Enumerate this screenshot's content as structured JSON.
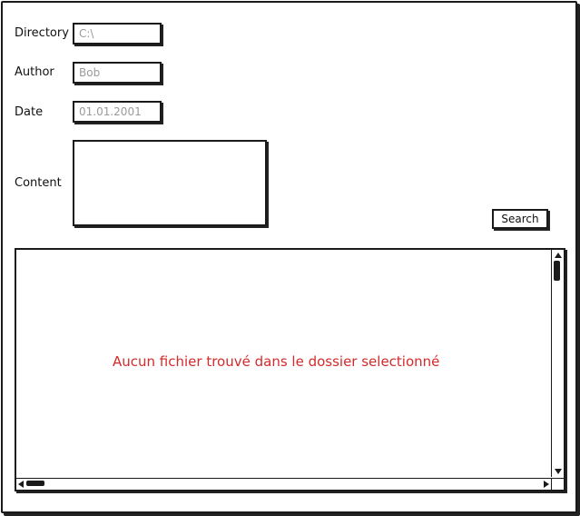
{
  "form": {
    "directory": {
      "label": "Directory",
      "value": "C:\\"
    },
    "author": {
      "label": "Author",
      "value": "Bob"
    },
    "date": {
      "label": "Date",
      "value": "01.01.2001"
    },
    "content": {
      "label": "Content",
      "value": ""
    }
  },
  "actions": {
    "search_label": "Search"
  },
  "results": {
    "empty_message": "Aucun fichier trouvé dans le dossier selectionné"
  },
  "colors": {
    "empty_message": "#d42a2a",
    "placeholder_text": "#9a9a9a",
    "border": "#1a1a1a"
  }
}
